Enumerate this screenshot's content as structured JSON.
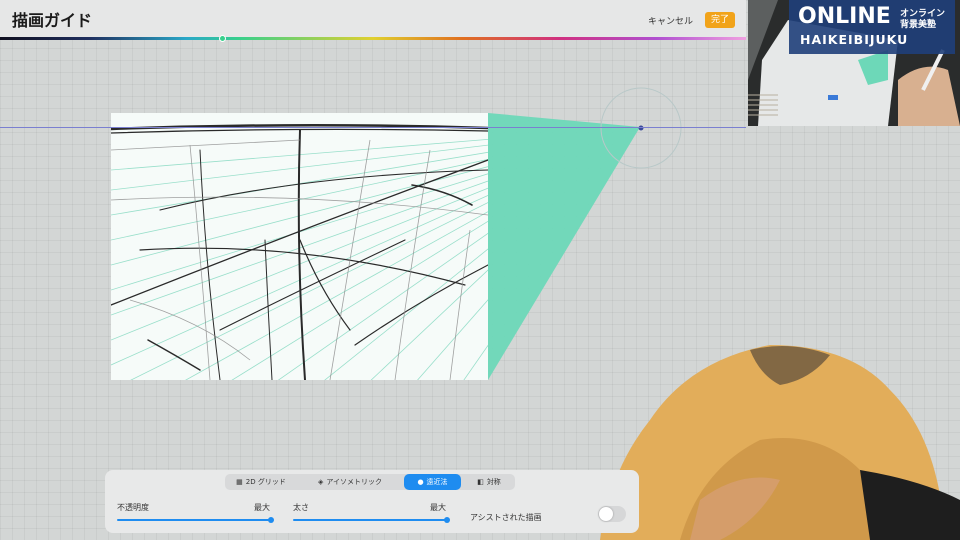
{
  "header": {
    "title": "描画ガイド",
    "cancel_label": "キャンセル",
    "done_label": "完了",
    "color_bar_accent": "#38d08c"
  },
  "guide": {
    "horizon_color": "#7a7fd0",
    "fill_color": "#6dd8b8"
  },
  "panel": {
    "tabs": [
      {
        "label": "2D グリッド",
        "icon": "grid-icon",
        "active": false
      },
      {
        "label": "アイソメトリック",
        "icon": "cube-icon",
        "active": false
      },
      {
        "label": "遠近法",
        "icon": "perspective-icon",
        "active": true
      },
      {
        "label": "対称",
        "icon": "symmetry-icon",
        "active": false
      }
    ],
    "opacity": {
      "label": "不透明度",
      "max_label": "最大",
      "value": 1.0
    },
    "thickness": {
      "label": "太さ",
      "max_label": "最大",
      "value": 1.0
    },
    "assist": {
      "label": "アシストされた描画",
      "enabled": false
    },
    "accent_color": "#1e8cf0"
  },
  "overlay": {
    "logo_online": "ONLINE",
    "logo_jp_line1": "オンライン",
    "logo_jp_line2": "背景美塾",
    "logo_bottom": "HAIKEIBIJUKU"
  }
}
